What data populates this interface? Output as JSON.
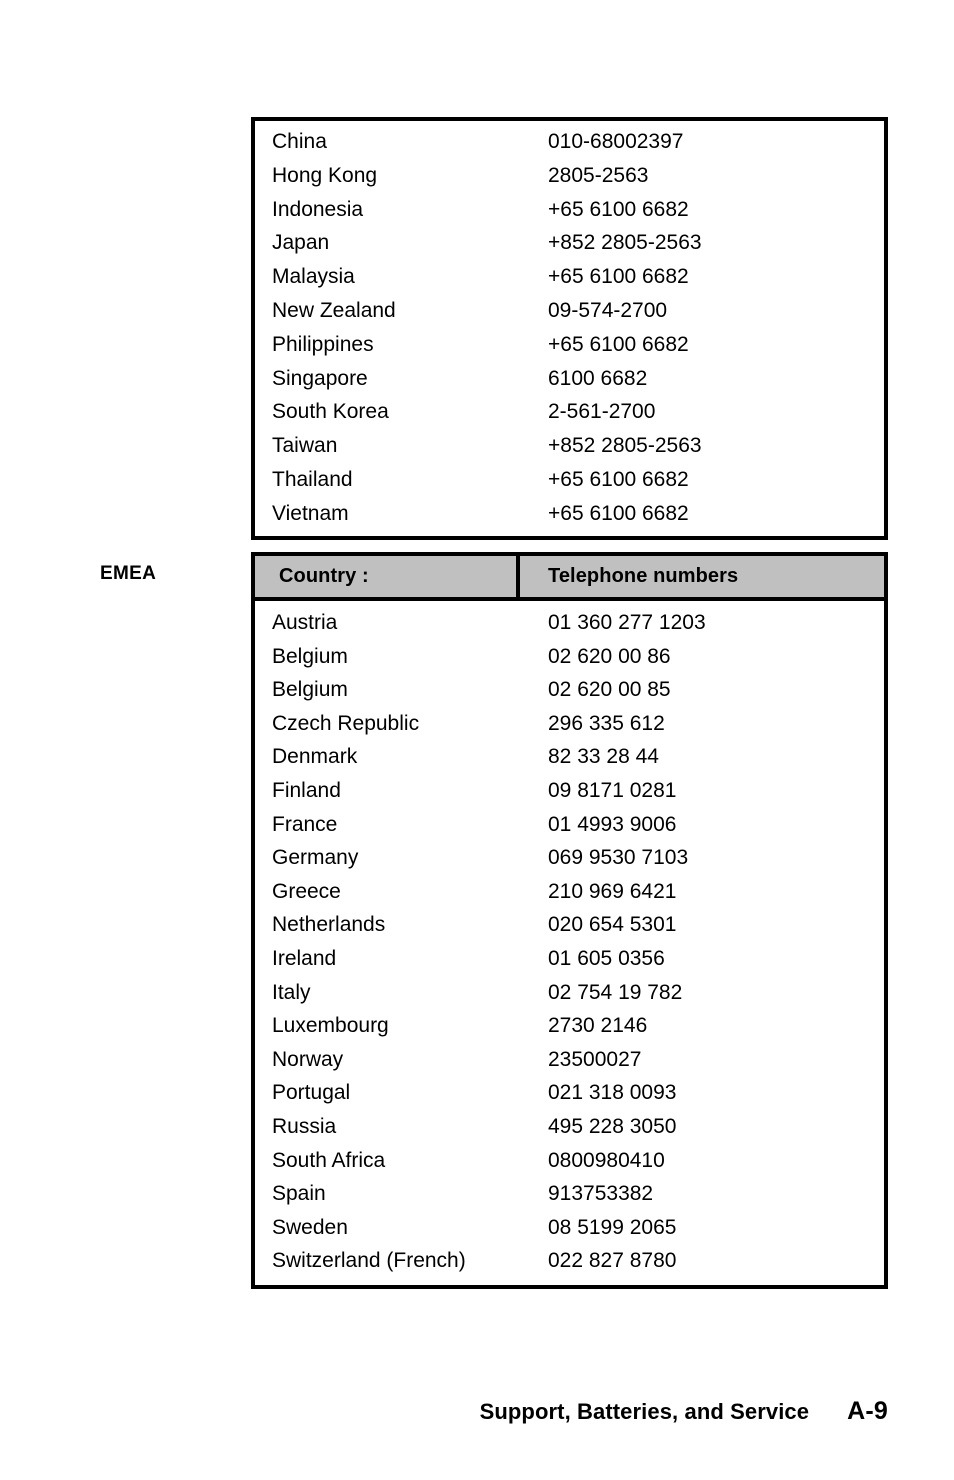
{
  "page": {
    "region_label": "EMEA",
    "footer": {
      "title": "Support, Batteries, and Service",
      "page_number": "A-9"
    },
    "colors": {
      "header_background": "#c0c0c0",
      "border": "#000000",
      "text": "#000000",
      "page_background": "#ffffff"
    }
  },
  "tables": [
    {
      "id": "apac-continued",
      "has_header": false,
      "columns": [
        "Country :",
        "Telephone numbers"
      ],
      "rows": [
        {
          "country": "China",
          "phone": "010-68002397"
        },
        {
          "country": "Hong Kong",
          "phone": "2805-2563"
        },
        {
          "country": "Indonesia",
          "phone": "+65 6100 6682"
        },
        {
          "country": "Japan",
          "phone": "+852 2805-2563"
        },
        {
          "country": "Malaysia",
          "phone": "+65 6100 6682"
        },
        {
          "country": "New Zealand",
          "phone": "09-574-2700"
        },
        {
          "country": "Philippines",
          "phone": "+65 6100 6682"
        },
        {
          "country": "Singapore",
          "phone": "6100 6682"
        },
        {
          "country": "South Korea",
          "phone": "2-561-2700"
        },
        {
          "country": "Taiwan",
          "phone": "+852 2805-2563"
        },
        {
          "country": "Thailand",
          "phone": "+65 6100 6682"
        },
        {
          "country": "Vietnam",
          "phone": "+65 6100 6682"
        }
      ]
    },
    {
      "id": "emea",
      "has_header": true,
      "header": {
        "country": "Country :",
        "phone": "Telephone numbers"
      },
      "rows": [
        {
          "country": "Austria",
          "phone": "01 360 277 1203"
        },
        {
          "country": "Belgium",
          "phone": "02 620 00 86"
        },
        {
          "country": "Belgium",
          "phone": "02 620 00 85"
        },
        {
          "country": "Czech Republic",
          "phone": "296 335 612"
        },
        {
          "country": "Denmark",
          "phone": "82 33 28 44"
        },
        {
          "country": "Finland",
          "phone": "09 8171 0281"
        },
        {
          "country": "France",
          "phone": "01 4993 9006"
        },
        {
          "country": "Germany",
          "phone": "069 9530 7103"
        },
        {
          "country": "Greece",
          "phone": "210 969 6421"
        },
        {
          "country": "Netherlands",
          "phone": "020 654 5301"
        },
        {
          "country": "Ireland",
          "phone": "01 605 0356"
        },
        {
          "country": "Italy",
          "phone": "02 754 19 782"
        },
        {
          "country": "Luxembourg",
          "phone": "2730 2146"
        },
        {
          "country": "Norway",
          "phone": "23500027"
        },
        {
          "country": "Portugal",
          "phone": "021 318 0093"
        },
        {
          "country": "Russia",
          "phone": "495 228 3050"
        },
        {
          "country": "South Africa",
          "phone": "0800980410"
        },
        {
          "country": "Spain",
          "phone": "913753382"
        },
        {
          "country": "Sweden",
          "phone": "08 5199 2065"
        },
        {
          "country": "Switzerland (French)",
          "phone": "022 827 8780"
        }
      ]
    }
  ]
}
